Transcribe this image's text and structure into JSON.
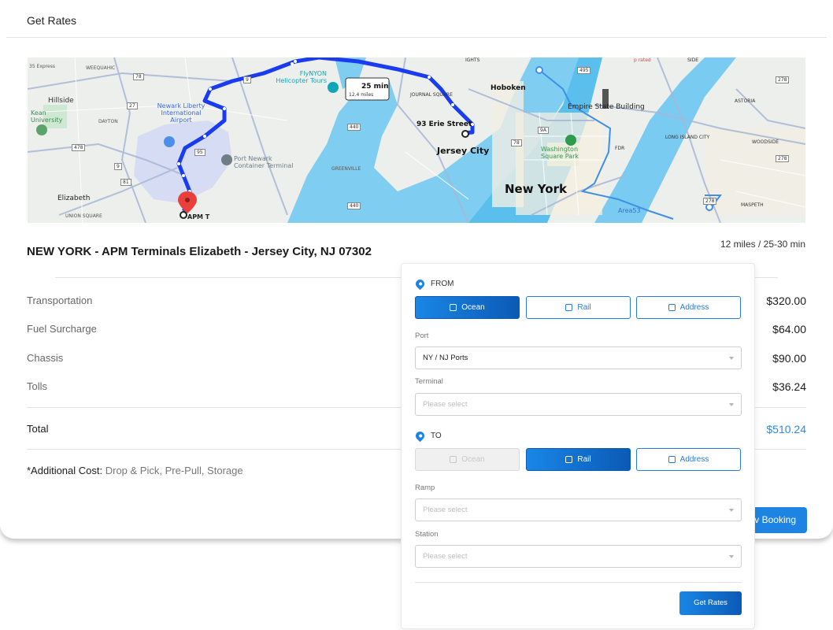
{
  "header": {
    "title": "Get Rates"
  },
  "map": {
    "labels": {
      "weequahic": "WEEQUAHIC",
      "hillside": "Hillside",
      "kean": "Kean University",
      "dayton": "DAYTON",
      "newark_airport": "Newark Liberty International Airport",
      "elizabeth": "Elizabeth",
      "union_square": "UNION SQUARE",
      "apm": "APM T",
      "port_newark": "Port Newark Container Terminal",
      "greenville": "GREENVILLE",
      "flynyon": "FlyNYON Helicopter Tours",
      "journal_square": "JOURNAL SQUARE",
      "erie_street": "93 Erie Street",
      "jersey_city": "Jersey City",
      "hoboken": "Hoboken",
      "new_york": "New York",
      "empire_state": "Empire State Building",
      "washington_square": "Washington Square Park",
      "astoria": "ASTORIA",
      "long_island_city": "LONG ISLAND CITY",
      "woodside": "WOODSIDE",
      "maspeth": "MASPETH",
      "area53": "Area53",
      "fdr": "FDR",
      "heights": "IGHTS",
      "east_side": "SIDE",
      "rated": "p rated",
      "express": "35 Express"
    },
    "route_badge": {
      "time": "25 min",
      "distance": "12.4 miles"
    },
    "shields": [
      "78",
      "9",
      "27",
      "478",
      "9",
      "81",
      "95",
      "440",
      "440",
      "78",
      "9A",
      "495",
      "278",
      "278",
      "278"
    ]
  },
  "route": {
    "title": "NEW YORK - APM Terminals Elizabeth - Jersey City, NJ 07302",
    "meta": "12 miles / 25-30 min"
  },
  "costs": [
    {
      "label": "Transportation",
      "value": "$320.00"
    },
    {
      "label": "Fuel Surcharge",
      "value": "$64.00"
    },
    {
      "label": "Chassis",
      "value": "$90.00"
    },
    {
      "label": "Tolls",
      "value": "$36.24"
    }
  ],
  "total": {
    "label": "Total",
    "value": "$510.24"
  },
  "additional": {
    "prefix": "*Additional Cost:",
    "text": " Drop & Pick, Pre-Pull, Storage"
  },
  "booking_button": "v Booking",
  "panel": {
    "from": {
      "heading": "FROM",
      "modes": {
        "ocean": "Ocean",
        "rail": "Rail",
        "address": "Address"
      },
      "port_label": "Port",
      "port_value": "NY / NJ Ports",
      "terminal_label": "Terminal",
      "terminal_placeholder": "Please select"
    },
    "to": {
      "heading": "TO",
      "modes": {
        "ocean": "Ocean",
        "rail": "Rail",
        "address": "Address"
      },
      "ramp_label": "Ramp",
      "ramp_placeholder": "Please select",
      "station_label": "Station",
      "station_placeholder": "Please select"
    },
    "submit": "Get Rates"
  },
  "colors": {
    "accent": "#1e84e3",
    "route": "#1a3cf0",
    "water": "#7fcef2",
    "total": "#2b8ae6"
  }
}
